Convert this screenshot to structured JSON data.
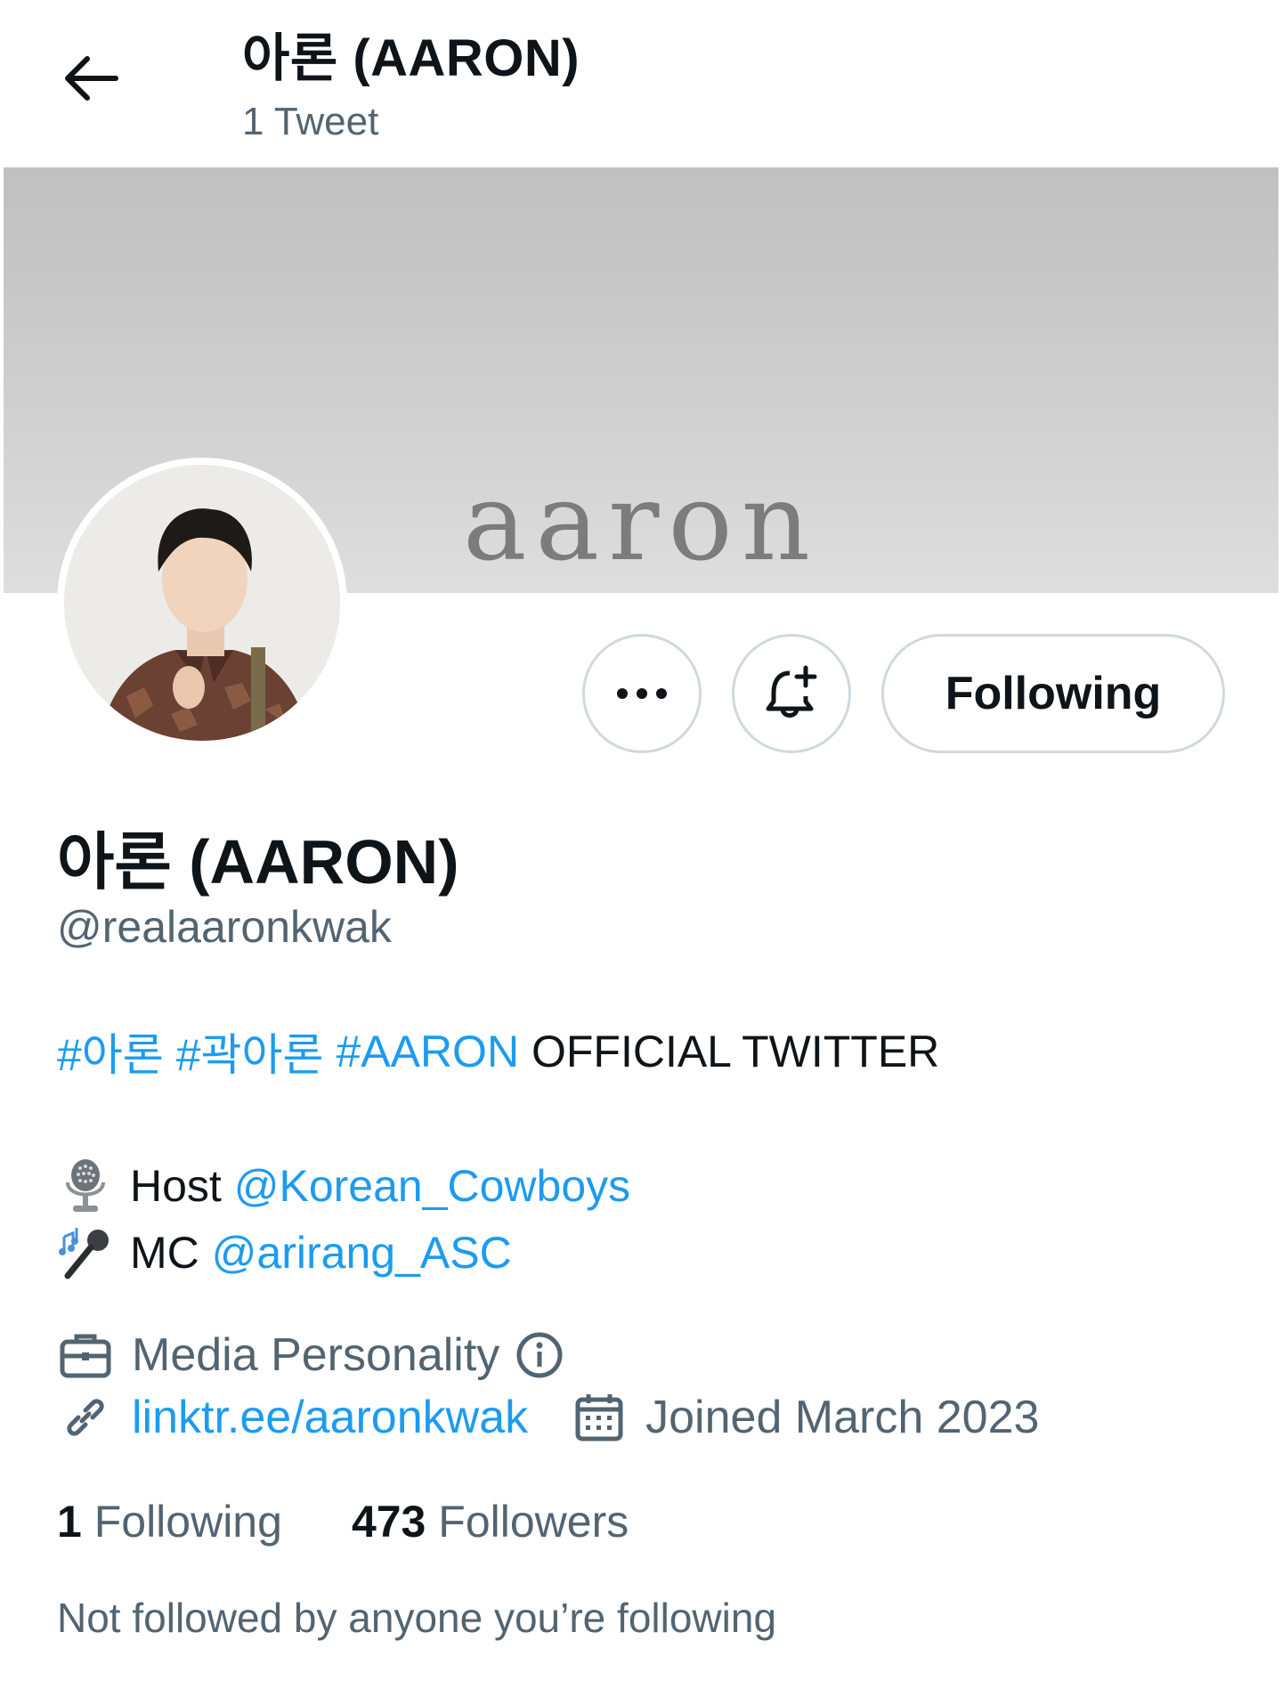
{
  "header": {
    "title": "아론 (AARON)",
    "tweet_count": "1 Tweet"
  },
  "banner": {
    "logo_text": "aaron"
  },
  "actions": {
    "more": "more-icon",
    "notify": "bell-plus-icon",
    "following_label": "Following"
  },
  "profile": {
    "display_name": "아론 (AARON)",
    "handle": "@realaaronkwak",
    "bio": {
      "hashtags": [
        "#아론",
        "#곽아론",
        "#AARON"
      ],
      "tagline": "OFFICIAL TWITTER",
      "line2_prefix": "Host",
      "line2_mention": "@Korean_Cowboys",
      "line3_prefix": "MC",
      "line3_mention": "@arirang_ASC"
    },
    "category": "Media Personality",
    "website": "linktr.ee/aaronkwak",
    "joined": "Joined March 2023"
  },
  "stats": {
    "following_count": "1",
    "following_label": "Following",
    "followers_count": "473",
    "followers_label": "Followers"
  },
  "followed_by": "Not followed by anyone you’re following",
  "colors": {
    "link": "#1d9bf0",
    "secondary_text": "#536471",
    "primary_text": "#0f1419",
    "border": "#cfd9de"
  }
}
